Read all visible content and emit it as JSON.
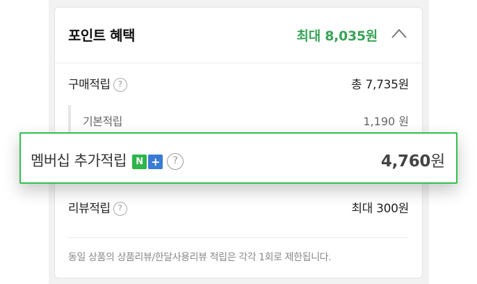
{
  "header": {
    "title": "포인트 혜택",
    "max_point": "최대 8,035원"
  },
  "purchase": {
    "label": "구매적립",
    "value": "총 7,735원"
  },
  "basic": {
    "label": "기본적립",
    "value": "1,190 원"
  },
  "membership": {
    "label": "멤버십 추가적립",
    "badge_n": "N",
    "badge_plus": "+",
    "amount": "4,760",
    "unit": "원"
  },
  "review": {
    "label": "리뷰적립",
    "value": "최대 300원"
  },
  "notice": "동일 상품의 상품리뷰/한달사용리뷰 적립은 각각 1회로 제한됩니다.",
  "help_glyph": "?",
  "icons": {
    "collapse": "chevron-up-icon",
    "help": "question-circle-icon"
  },
  "colors": {
    "accent_green": "#38a356",
    "highlight_border": "#2fc04a",
    "badge_n": "#2db64a",
    "badge_plus": "#3a7bd5"
  }
}
